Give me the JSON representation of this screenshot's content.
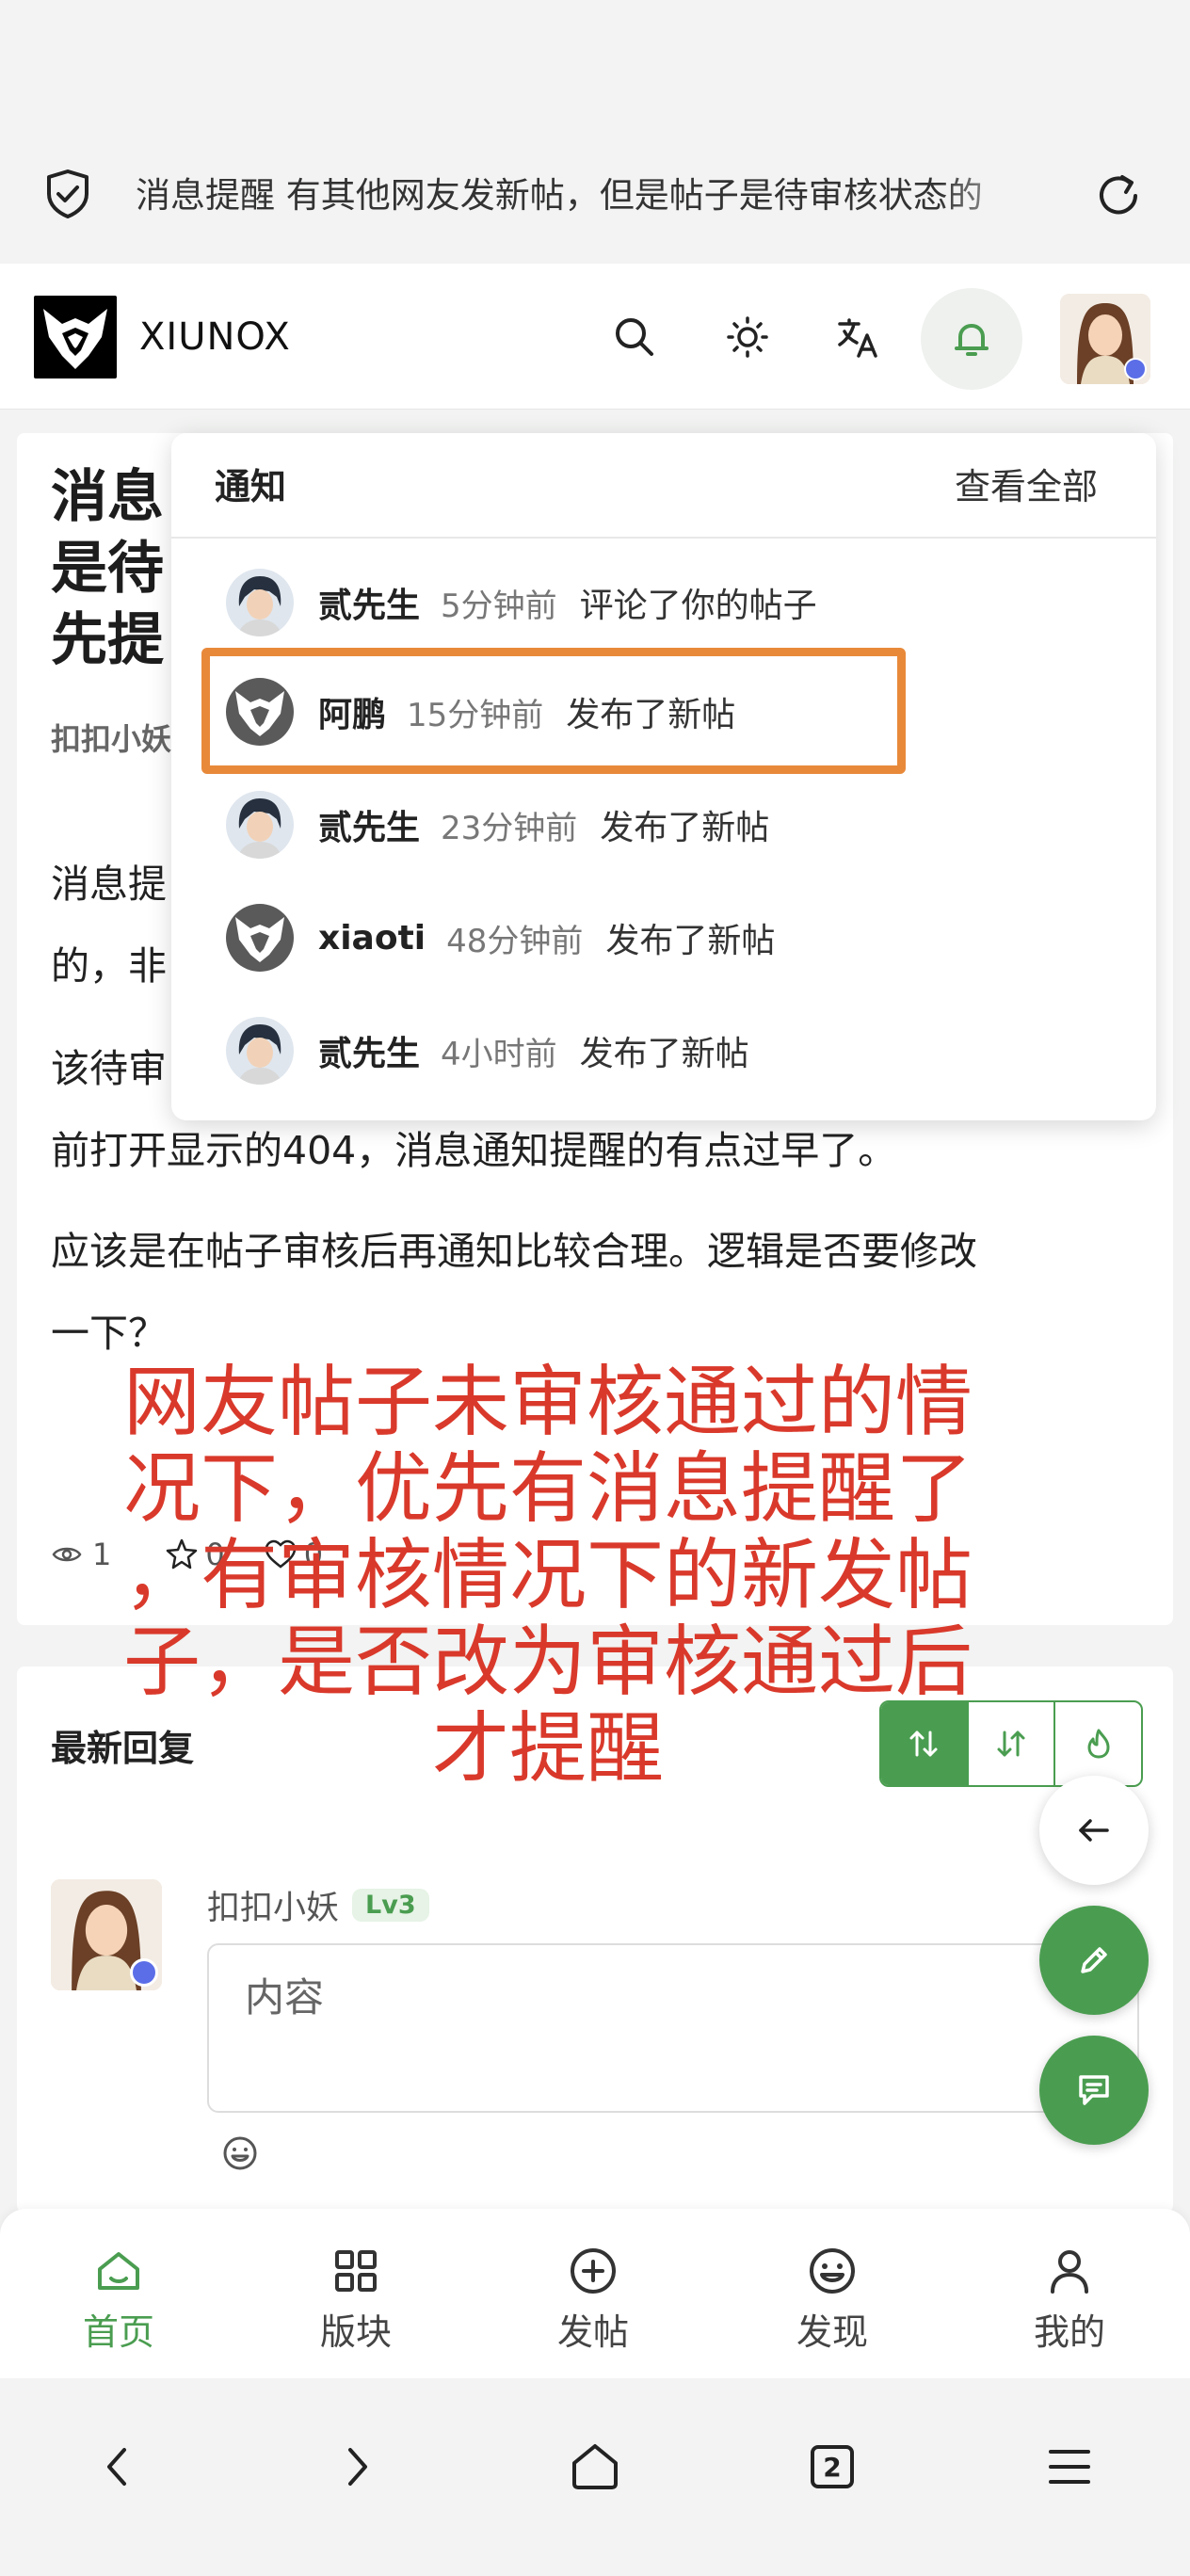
{
  "browser": {
    "url_text": "消息提醒 有其他网友发新帖，但是帖子是待审核状态的",
    "tab_count": "2"
  },
  "header": {
    "brand": "XIUNOX"
  },
  "post": {
    "title": "消息提醒 有其他网友发新帖，但是帖子是待审核状态的，非审核情况下，优先提醒了",
    "title_lines": [
      "消息",
      "是待",
      "先提"
    ],
    "author": "扣扣小妖",
    "paragraph1_lines": [
      "消息提",
      "的，非"
    ],
    "paragraph2_lines": [
      "该待审",
      "前打开显示的404，消息通知提醒的有点过早了。"
    ],
    "paragraph3_lines": [
      "应该是在帖子审核后再通知比较合理。逻辑是否要修改",
      "一下？"
    ],
    "views": "1",
    "favorites": "0",
    "likes": "0"
  },
  "notifications": {
    "title": "通知",
    "view_all": "查看全部",
    "items": [
      {
        "name": "贰先生",
        "time": "5分钟前",
        "action": "评论了你的帖子",
        "avatar": "anime-boy"
      },
      {
        "name": "阿鹏",
        "time": "15分钟前",
        "action": "发布了新帖",
        "avatar": "xiunox-logo"
      },
      {
        "name": "贰先生",
        "time": "23分钟前",
        "action": "发布了新帖",
        "avatar": "anime-boy"
      },
      {
        "name": "xiaoti",
        "time": "48分钟前",
        "action": "发布了新帖",
        "avatar": "xiunox-logo"
      },
      {
        "name": "贰先生",
        "time": "4小时前",
        "action": "发布了新帖",
        "avatar": "anime-boy"
      }
    ]
  },
  "annotation": {
    "lines": [
      "网友帖子未审核通过的情",
      "况下，优先有消息提醒了",
      "，有审核情况下的新发帖",
      "子，是否改为审核通过后",
      "才提醒"
    ],
    "color": "#d9392b"
  },
  "replies": {
    "title": "最新回复",
    "user": "扣扣小妖",
    "level": "Lv3",
    "placeholder": "内容"
  },
  "tabs": [
    {
      "label": "首页",
      "icon": "home-icon",
      "active": true
    },
    {
      "label": "版块",
      "icon": "grid-icon",
      "active": false
    },
    {
      "label": "发帖",
      "icon": "plus-circle-icon",
      "active": false
    },
    {
      "label": "发现",
      "icon": "smile-icon",
      "active": false
    },
    {
      "label": "我的",
      "icon": "user-icon",
      "active": false
    }
  ],
  "colors": {
    "accent": "#4a9d50",
    "highlight": "#e8893a"
  }
}
